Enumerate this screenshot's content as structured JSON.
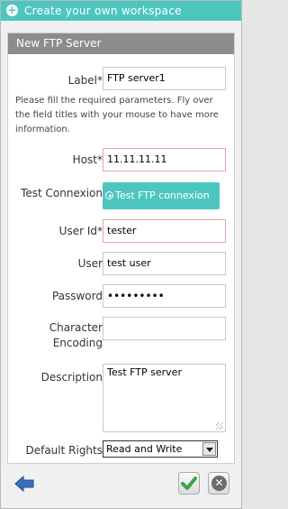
{
  "window": {
    "title": "Create your own workspace",
    "title_icon": "plus-circle-icon",
    "accent": "#4ec6c0"
  },
  "form": {
    "title": "New FTP Server",
    "help_text": "Please fill the required parameters. Fly over the field titles with your mouse to have more information.",
    "label": {
      "label": "Label*",
      "value": "FTP server1"
    },
    "host": {
      "label": "Host*",
      "value": "11.11.11.11"
    },
    "test_connexion": {
      "label": "Test Connexion",
      "button": "Test FTP connexion",
      "icon": "play-circle-icon"
    },
    "user_id": {
      "label": "User Id*",
      "value": "tester"
    },
    "user": {
      "label": "User",
      "value": "test user"
    },
    "password": {
      "label": "Password",
      "value": "•••••••••"
    },
    "encoding": {
      "label": "Character Encoding",
      "value": ""
    },
    "description": {
      "label": "Description",
      "value": "Test FTP server"
    },
    "rights": {
      "label": "Default Rights",
      "value": "Read and Write"
    }
  },
  "footer": {
    "back_icon": "back-arrow-icon",
    "ok_icon": "checkmark-icon",
    "cancel_icon": "close-icon"
  }
}
